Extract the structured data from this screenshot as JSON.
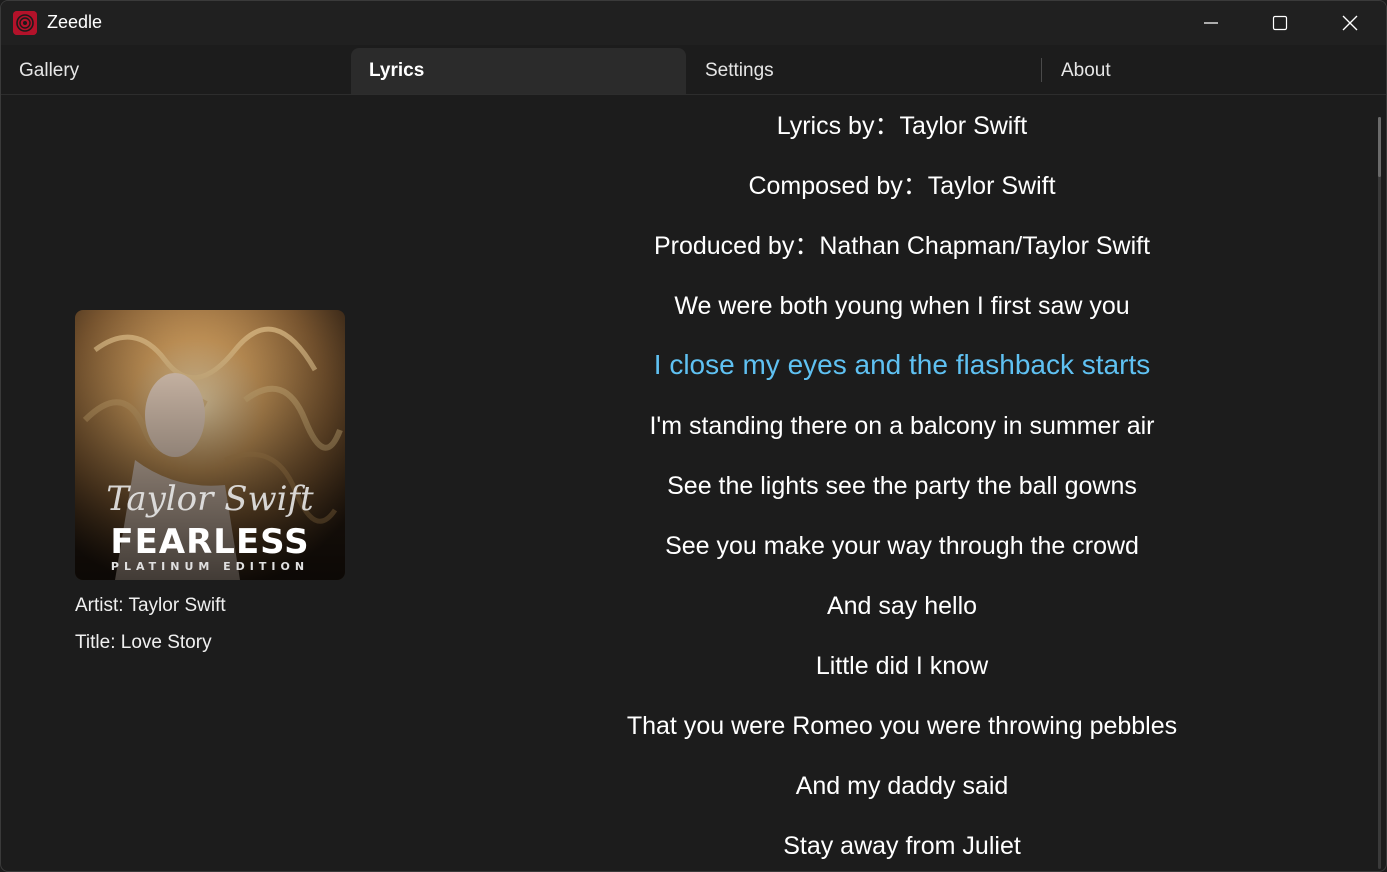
{
  "window": {
    "title": "Zeedle",
    "icon": "zeedle-app-icon",
    "controls": [
      "minimize-icon",
      "maximize-icon",
      "close-icon"
    ]
  },
  "tabs": [
    {
      "label": "Gallery",
      "selected": false
    },
    {
      "label": "Lyrics",
      "selected": true
    },
    {
      "label": "Settings",
      "selected": false
    },
    {
      "label": "About",
      "selected": false
    }
  ],
  "track": {
    "artist_text": "Artist: Taylor Swift",
    "title_text": "Title: Love Story",
    "cover": {
      "script_text": "Taylor Swift",
      "album_text": "FEARLESS",
      "edition_text": "PLATINUM EDITION"
    }
  },
  "lyrics": {
    "active_index": 4,
    "active_color": "#5fc1f2",
    "lines": [
      "Lyrics by：Taylor Swift",
      "Composed by：Taylor Swift",
      "Produced by：Nathan Chapman/Taylor Swift",
      "We were both young when I first saw you",
      "I close my eyes and the flashback starts",
      "I'm standing there on a balcony in summer air",
      "See the lights see the party the ball gowns",
      "See you make your way through the crowd",
      "And say hello",
      "Little did I know",
      "That you were Romeo you were throwing pebbles",
      "And my daddy said",
      "Stay away from Juliet"
    ]
  }
}
